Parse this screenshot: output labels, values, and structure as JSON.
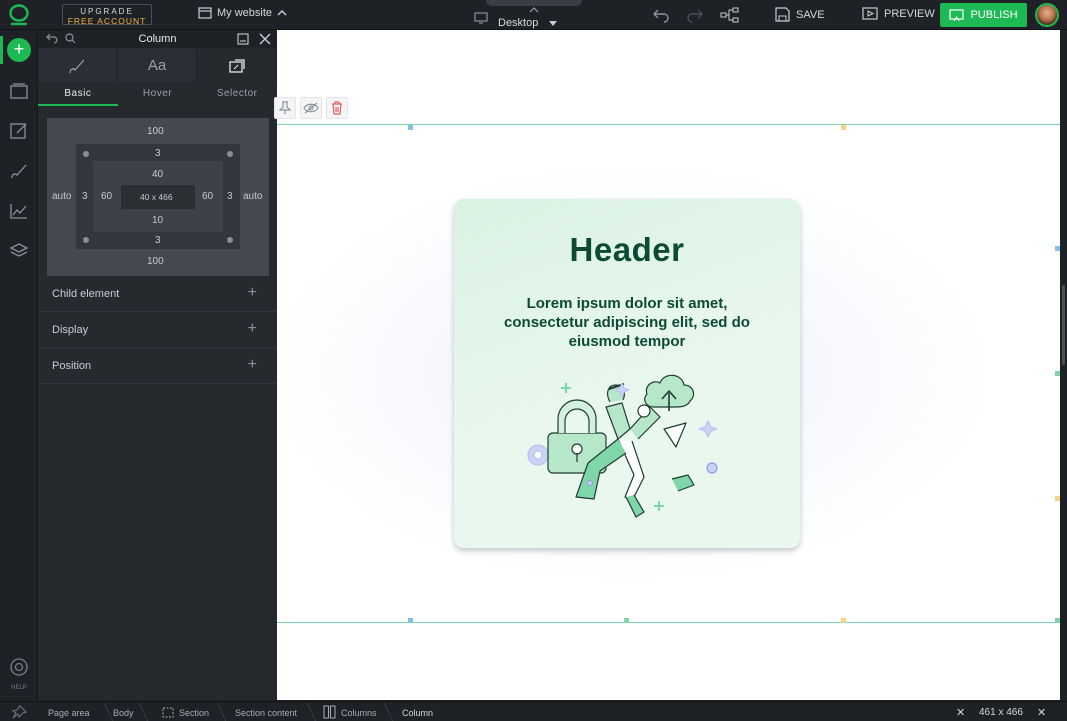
{
  "topbar": {
    "upgrade_line1": "UPGRADE",
    "upgrade_line2": "FREE ACCOUNT",
    "site_name": "My website",
    "device": "Desktop",
    "save_label": "SAVE",
    "preview_label": "PREVIEW",
    "publish_label": "PUBLISH"
  },
  "rail": {
    "add_label": "+",
    "help_label": "HELP"
  },
  "panel": {
    "title": "Column",
    "icon_tab_typography": "Aa",
    "subtabs": [
      "Basic",
      "Hover",
      "Selector"
    ],
    "box": {
      "margin_top": "100",
      "margin_bottom": "100",
      "margin_left": "auto",
      "margin_right": "auto",
      "border_top": "3",
      "border_bottom": "3",
      "border_left": "3",
      "border_right": "3",
      "padding_top": "40",
      "padding_bottom": "10",
      "padding_left": "60",
      "padding_right": "60",
      "size": "40 x 466"
    },
    "sections": [
      "Child element",
      "Display",
      "Position"
    ],
    "expand_symbol": "+"
  },
  "card": {
    "header": "Header",
    "body": "Lorem ipsum dolor sit amet, consectetur adipiscing elit, sed do eiusmod tempor"
  },
  "statusbar": {
    "crumbs": [
      "Page area",
      "Body",
      "Section",
      "Section content",
      "Columns",
      "Column"
    ],
    "close_symbol": "✕",
    "dimensions": "461 x 466"
  },
  "colors": {
    "accent": "#1db954",
    "upgrade_text": "#f2b43c",
    "card_text": "#0c4a36",
    "section_border": "#7fd6a9"
  }
}
